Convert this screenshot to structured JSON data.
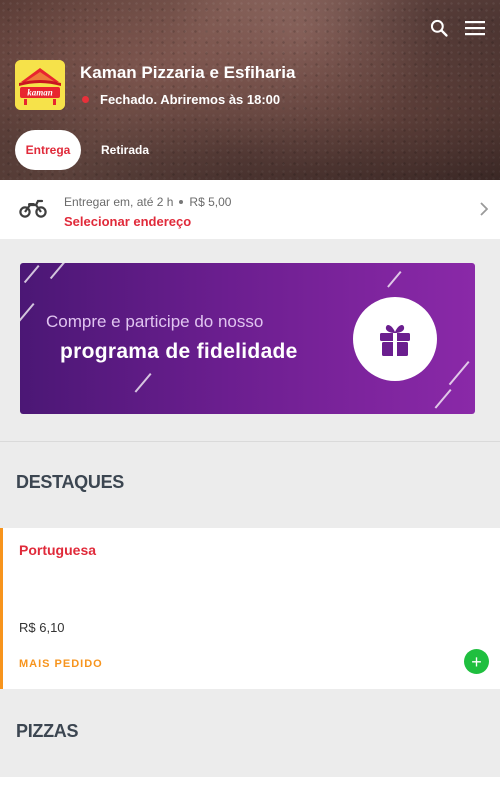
{
  "store": {
    "name": "Kaman Pizzaria e Esfiharia",
    "status": "Fechado. Abriremos às 18:00",
    "logo_text": "kaman",
    "icons": {
      "search": "search-icon",
      "menu": "menu-icon"
    }
  },
  "tabs": [
    {
      "label": "Entrega",
      "active": true
    },
    {
      "label": "Retirada",
      "active": false
    }
  ],
  "delivery": {
    "prefix": "Entregar em,",
    "time": "até 2 h",
    "fee": "R$ 5,00",
    "address_cta": "Selecionar endereço",
    "icon": "motorcycle-icon"
  },
  "banner": {
    "line1": "Compre e participe do nosso",
    "line2": "programa de fidelidade",
    "icon": "gift-icon"
  },
  "sections": {
    "highlights_title": "DESTAQUES",
    "pizzas_title": "PIZZAS"
  },
  "featured_item": {
    "name": "Portuguesa",
    "price": "R$ 6,10",
    "badge": "MAIS PEDIDO",
    "add_label": "+"
  },
  "colors": {
    "brand_red": "#e02a3a",
    "accent_orange": "#f7941d",
    "add_green": "#1fbf3f",
    "banner_purple": "#6b1e8f"
  }
}
